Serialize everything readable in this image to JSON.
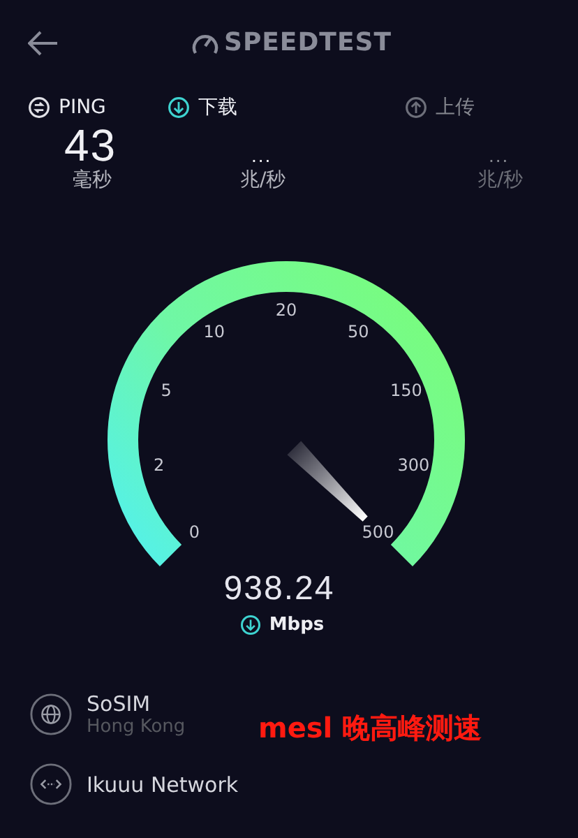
{
  "header": {
    "title": "SPEEDTEST"
  },
  "stats": [
    {
      "kind": "ping",
      "label": "PING",
      "value": "43",
      "unit": "毫秒",
      "selected": false,
      "pending": false
    },
    {
      "kind": "download",
      "label": "下载",
      "value": "...",
      "unit": "兆/秒",
      "selected": true,
      "pending": false
    },
    {
      "kind": "upload",
      "label": "上传",
      "value": "...",
      "unit": "兆/秒",
      "selected": false,
      "pending": true
    }
  ],
  "gauge": {
    "ticks": [
      "0",
      "2",
      "5",
      "10",
      "20",
      "50",
      "150",
      "300",
      "500"
    ],
    "reading": "938.24",
    "unit": "Mbps"
  },
  "servers": [
    {
      "kind": "globe",
      "name": "SoSIM",
      "location": "Hong Kong"
    },
    {
      "kind": "network",
      "name": "Ikuuu Network"
    }
  ],
  "annotation": "mesl 晚高峰测速"
}
